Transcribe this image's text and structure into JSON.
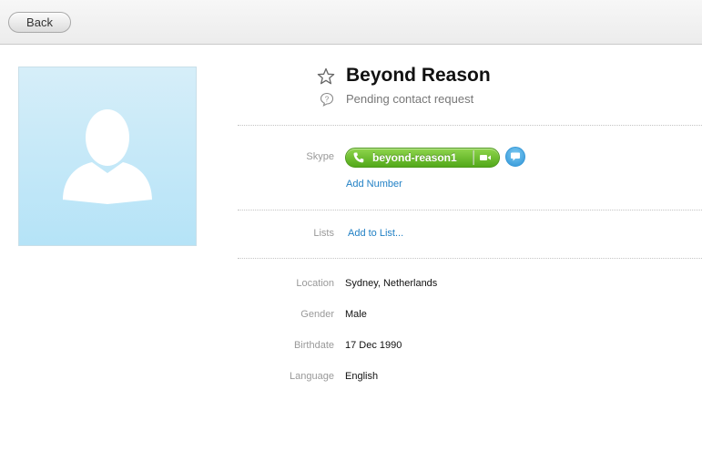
{
  "toolbar": {
    "back_label": "Back"
  },
  "profile": {
    "name": "Beyond Reason",
    "status": "Pending contact request",
    "avatar_icon": "default-person-silhouette",
    "star_icon": "star-outline-icon",
    "pending_icon": "question-bubble-icon"
  },
  "skype": {
    "label": "Skype",
    "username": "beyond-reason1",
    "call_icon": "phone-icon",
    "video_icon": "video-camera-icon",
    "chat_icon": "chat-bubble-icon",
    "add_number": "Add Number"
  },
  "lists": {
    "label": "Lists",
    "add_to_list": "Add to List..."
  },
  "details": [
    {
      "label": "Location",
      "value": "Sydney, Netherlands"
    },
    {
      "label": "Gender",
      "value": "Male"
    },
    {
      "label": "Birthdate",
      "value": "17 Dec 1990"
    },
    {
      "label": "Language",
      "value": "English"
    }
  ],
  "colors": {
    "accent_link": "#1f7fc4",
    "call_green": "#52a81a",
    "chat_blue": "#2e94d6",
    "avatar_bg": "#c4e9f8"
  }
}
